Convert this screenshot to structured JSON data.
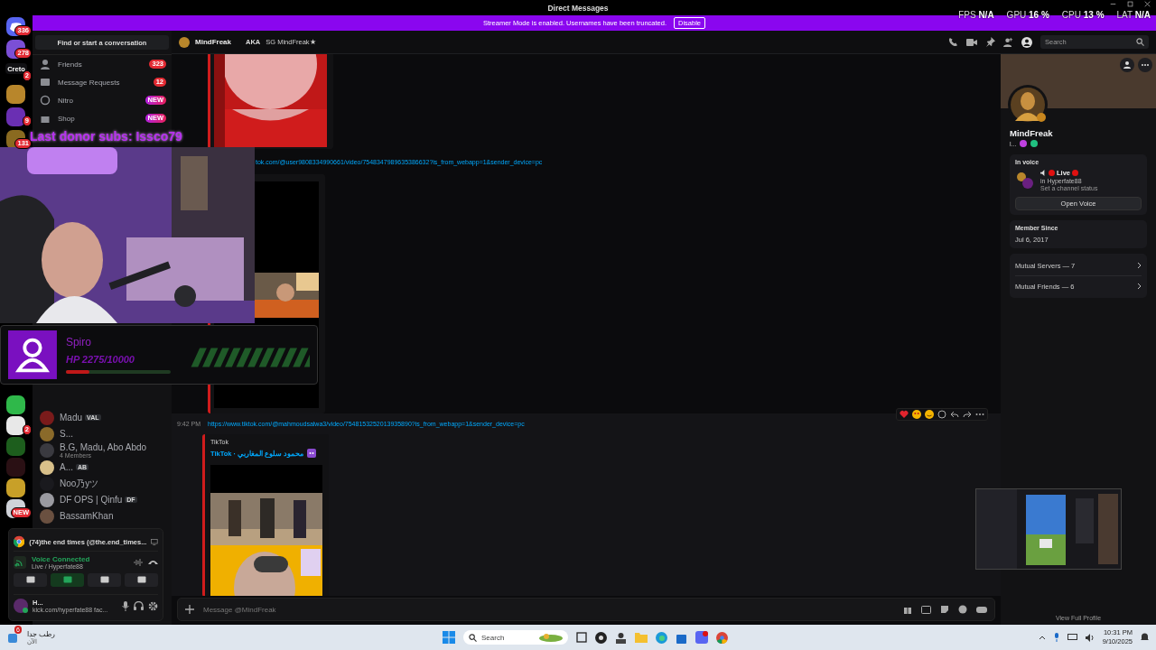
{
  "window": {
    "title": "Direct Messages"
  },
  "perf_overlay": [
    {
      "label": "FPS",
      "value": "N/A"
    },
    {
      "label": "GPU",
      "value": "16 %"
    },
    {
      "label": "CPU",
      "value": "13 %"
    },
    {
      "label": "LAT",
      "value": "N/A"
    }
  ],
  "banner": {
    "text": "Streamer Mode is enabled. Usernames have been truncated.",
    "button": "Disable"
  },
  "rail_top": [
    {
      "kind": "home",
      "badge": "336",
      "color": "#5865f2"
    },
    {
      "kind": "server",
      "badge": "278",
      "color": "#7b4fd6"
    },
    {
      "kind": "text",
      "label": "Creto",
      "badge": "2",
      "color": "#111114"
    },
    {
      "kind": "server",
      "color": "#b8862b"
    },
    {
      "kind": "server",
      "badge": "9",
      "color": "#6a2fb3"
    },
    {
      "kind": "server",
      "badge": "131",
      "color": "#8a6a20"
    }
  ],
  "rail_bottom": [
    {
      "color": "#2fb84a"
    },
    {
      "badge": "2",
      "color": "#e8e8e8"
    },
    {
      "color": "#1d5e1d"
    },
    {
      "color": "#2a1014"
    },
    {
      "color": "#c8a028"
    },
    {
      "badge": "NEW",
      "color": "#cfd2d8"
    }
  ],
  "dm_search": {
    "placeholder": "Find or start a conversation"
  },
  "nav": [
    {
      "label": "Friends",
      "badge": "323",
      "kind": "count"
    },
    {
      "label": "Message Requests",
      "badge": "12",
      "kind": "count"
    },
    {
      "label": "Nitro",
      "badge": "NEW",
      "kind": "new"
    },
    {
      "label": "Shop",
      "badge": "NEW",
      "kind": "new"
    }
  ],
  "dms": [
    {
      "name": "Madu",
      "tag": "VAL"
    },
    {
      "name": "S..."
    },
    {
      "name": "B.G, Madu, Abo Abdo",
      "subtitle": "4 Members"
    },
    {
      "name": "A...",
      "tag": "AB"
    },
    {
      "name": "Noo乃yツ"
    },
    {
      "name": "DF OPS | Qinfu",
      "tag": "DF"
    },
    {
      "name": "BassamKhan"
    }
  ],
  "activity": {
    "title": "(74)the end times (@the.end_times..."
  },
  "voice": {
    "status": "Voice Connected",
    "channel": "Live / Hyperfate88",
    "buttons": [
      {
        "on": false
      },
      {
        "on": true
      },
      {
        "on": false
      },
      {
        "on": false
      }
    ]
  },
  "user": {
    "name": "H...",
    "status": "kick.com/hyperfate88 fac..."
  },
  "chat_header": {
    "name": "MindFreak",
    "aka_label": "AKA",
    "aka": "SG MindFreak★",
    "search_placeholder": "Search"
  },
  "messages": [
    {
      "kind": "video"
    },
    {
      "kind": "link",
      "text": "tok.com/@user9808334990661/video/7548347989635386632?is_from_webapp=1&sender_device=pc"
    },
    {
      "kind": "tall_video"
    },
    {
      "kind": "message",
      "time": "9:42 PM",
      "link": "https://www.tiktok.com/@mahmoudsalwa3/video/7548153252013935890?is_from_webapp=1&sender_device=pc",
      "provider": "TikTok",
      "title": "TikTok · محمود سلوع المغاربي",
      "hovered": true
    }
  ],
  "composer": {
    "placeholder": "Message @MindFreak"
  },
  "profile": {
    "name": "MindFreak",
    "tag": "l...",
    "in_voice": {
      "heading": "In voice",
      "title": "Live",
      "channel": "in Hyperfate88",
      "hint": "Set a channel status",
      "button": "Open Voice"
    },
    "member_since": {
      "heading": "Member Since",
      "date": "Jul 6, 2017"
    },
    "mutuals": [
      "Mutual Servers — 7",
      "Mutual Friends — 6"
    ],
    "footer": "View Full Profile"
  },
  "stream_overlay": {
    "donor": "Last donor subs: Issco79",
    "player": {
      "name": "Spiro",
      "hp": "HP 2275/10000",
      "level": 0.2275
    }
  },
  "taskbar": {
    "weather": "رطب جدا",
    "weather_sub": "الآن",
    "weather_badge": "6",
    "search": "Search",
    "time": "10:31 PM",
    "date": "9/10/2025"
  }
}
